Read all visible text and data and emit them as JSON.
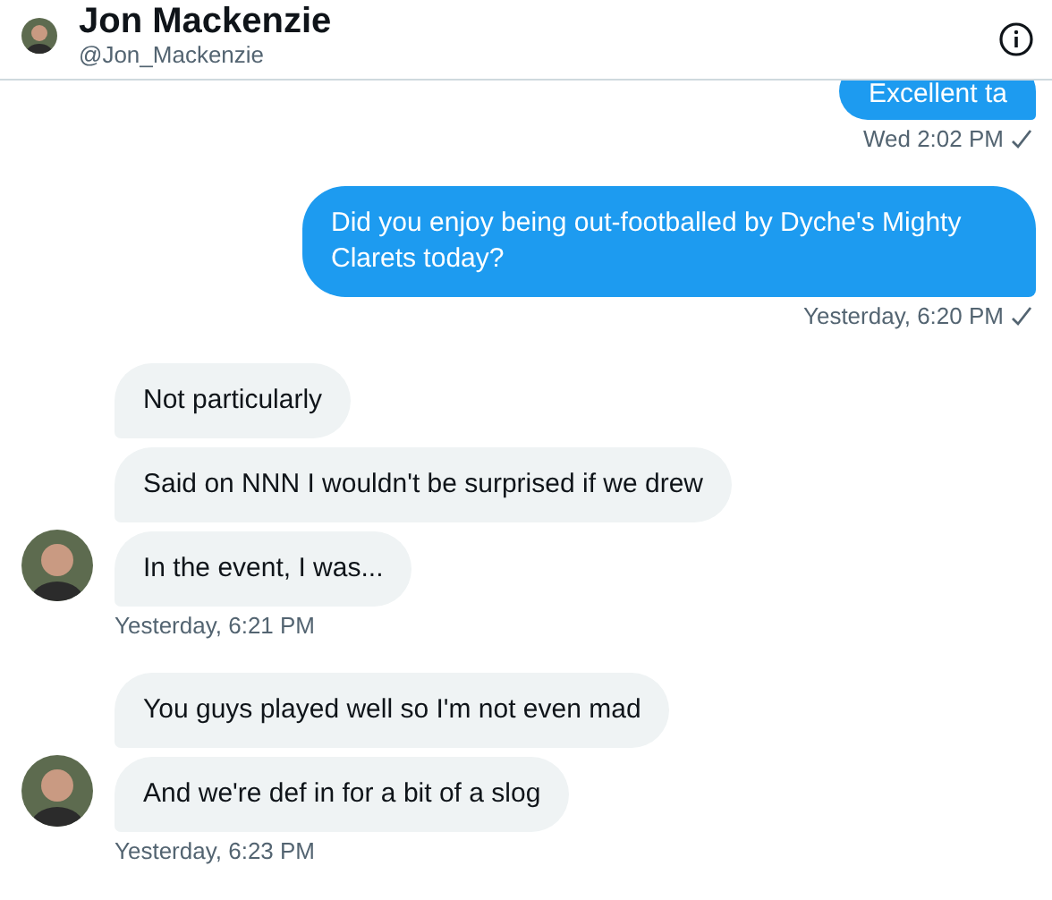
{
  "header": {
    "name": "Jon Mackenzie",
    "handle": "@Jon_Mackenzie"
  },
  "groups": [
    {
      "kind": "sent",
      "bubbles": [
        "Excellent ta"
      ],
      "time": "Wed 2:02 PM",
      "delivered": true
    },
    {
      "kind": "sent",
      "bubbles": [
        "Did you enjoy being out-footballed by Dyche's Mighty Clarets today?"
      ],
      "time": "Yesterday, 6:20 PM",
      "delivered": true
    },
    {
      "kind": "received",
      "bubbles": [
        "Not particularly",
        "Said on NNN I wouldn't be surprised if we drew",
        "In the event, I was..."
      ],
      "time": "Yesterday, 6:21 PM"
    },
    {
      "kind": "received",
      "bubbles": [
        "You guys played well so I'm not even mad",
        "And we're def in for a bit of a slog"
      ],
      "time": "Yesterday, 6:23 PM"
    }
  ]
}
